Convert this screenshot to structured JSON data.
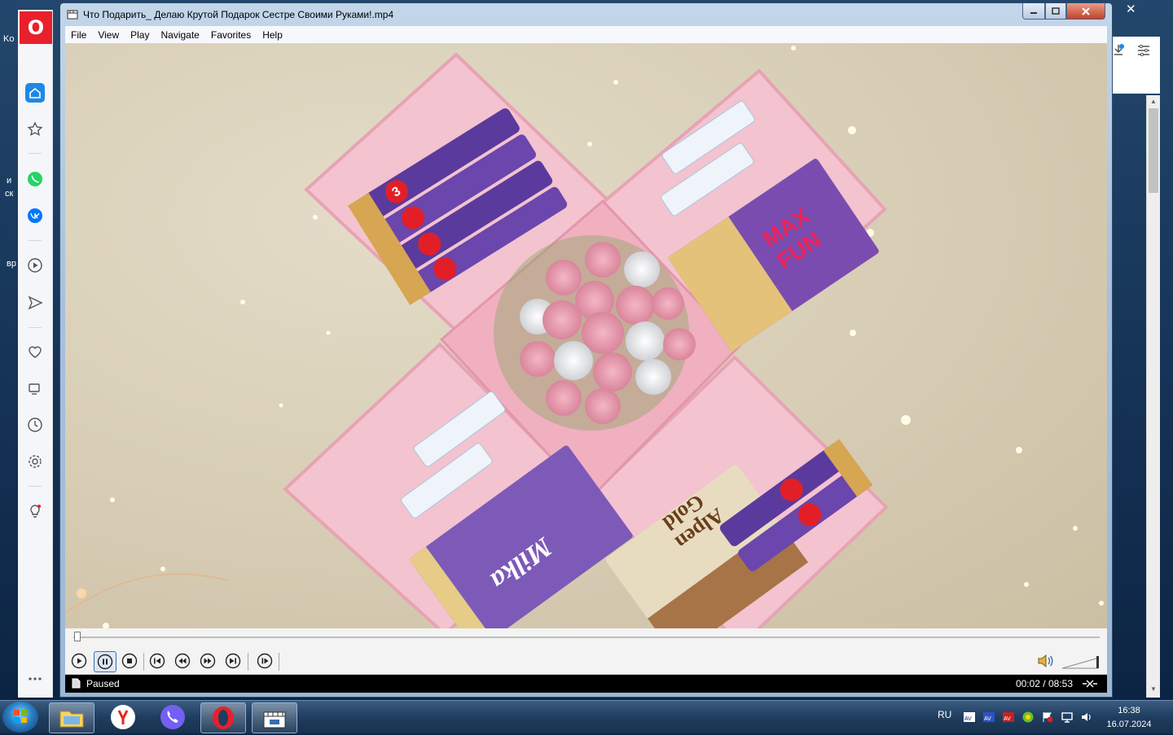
{
  "desktop": {
    "fragments": [
      "Ko",
      "и",
      "ск",
      "вр"
    ]
  },
  "browser": {
    "close_glyph": "✕",
    "sidebar": {
      "logo": "O",
      "items": [
        {
          "name": "home-icon"
        },
        {
          "name": "speed-dial-icon"
        },
        {
          "name": "whatsapp-icon"
        },
        {
          "name": "vk-icon"
        },
        {
          "name": "player-icon"
        },
        {
          "name": "send-icon"
        },
        {
          "name": "heart-icon"
        },
        {
          "name": "tabs-icon"
        },
        {
          "name": "history-icon"
        },
        {
          "name": "settings-icon"
        },
        {
          "name": "tips-icon"
        },
        {
          "name": "more-icon"
        }
      ]
    }
  },
  "player": {
    "title": "Что Подарить_ Делаю Крутой Подарок Сестре Своими Руками!.mp4",
    "menu": [
      "File",
      "View",
      "Play",
      "Navigate",
      "Favorites",
      "Help"
    ],
    "status": "Paused",
    "time": "00:02 / 08:53",
    "progress": 0.004,
    "controls": [
      "play",
      "pause",
      "stop",
      "prev",
      "rewind",
      "forward",
      "next",
      "frame-step"
    ],
    "active_control": "pause"
  },
  "video": {
    "labels": {
      "chocolate_brand": "Milka",
      "bar_brand": "3",
      "wafer_brand_top": "MAX",
      "wafer_brand_bottom": "FUN",
      "alpen_line1": "Alpen",
      "alpen_line2": "Gold"
    }
  },
  "taskbar": {
    "apps": [
      "explorer",
      "yandex",
      "viber",
      "opera",
      "media-player-classic"
    ],
    "language": "RU",
    "clock": {
      "time": "16:38",
      "date": "16.07.2024"
    }
  }
}
